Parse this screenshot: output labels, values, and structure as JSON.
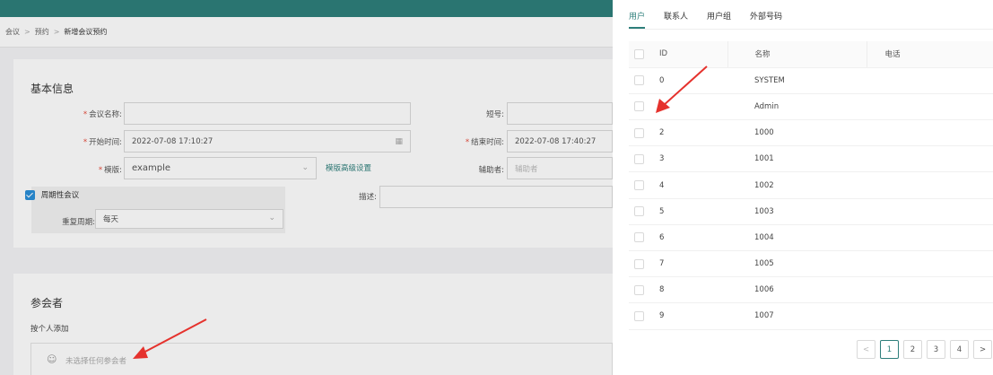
{
  "breadcrumb": [
    "会议",
    "预约",
    "新增会议预约"
  ],
  "basic": {
    "title": "基本信息",
    "meeting_name_label": "会议名称:",
    "short_no_label": "短号:",
    "start_label": "开始时间:",
    "start_value": "2022-07-08 17:10:27",
    "end_label": "结束时间:",
    "end_value": "2022-07-08 17:40:27",
    "template_label": "模版:",
    "template_value": "example",
    "template_link": "模版高级设置",
    "assistant_label": "辅助者:",
    "assistant_placeholder": "辅助者",
    "recurring_label": "周期性会议",
    "recurring_checked": true,
    "desc_label": "描述:",
    "repeat_label": "重复周期:",
    "repeat_value": "每天"
  },
  "participants": {
    "title": "参会者",
    "add_by_person": "按个人添加",
    "empty_text": "未选择任何参会者"
  },
  "drawer": {
    "tabs": [
      "用户",
      "联系人",
      "用户组",
      "外部号码"
    ],
    "active_tab": 0,
    "columns": [
      "ID",
      "名称",
      "电话"
    ],
    "rows": [
      {
        "id": "0",
        "name": "SYSTEM",
        "phone": ""
      },
      {
        "id": "",
        "name": "Admin",
        "phone": ""
      },
      {
        "id": "2",
        "name": "1000",
        "phone": ""
      },
      {
        "id": "3",
        "name": "1001",
        "phone": ""
      },
      {
        "id": "4",
        "name": "1002",
        "phone": ""
      },
      {
        "id": "5",
        "name": "1003",
        "phone": ""
      },
      {
        "id": "6",
        "name": "1004",
        "phone": ""
      },
      {
        "id": "7",
        "name": "1005",
        "phone": ""
      },
      {
        "id": "8",
        "name": "1006",
        "phone": ""
      },
      {
        "id": "9",
        "name": "1007",
        "phone": ""
      }
    ],
    "pagination": {
      "prev": "<",
      "pages": [
        "1",
        "2",
        "3",
        "4"
      ],
      "next": ">",
      "current": "1"
    }
  },
  "colors": {
    "accent": "#2e7f7b",
    "checkbox": "#2a8fd8",
    "arrow": "#e5322d"
  }
}
